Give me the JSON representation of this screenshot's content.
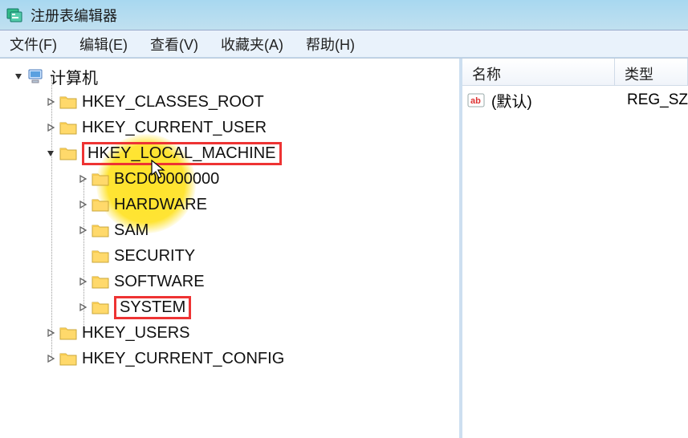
{
  "window": {
    "title": "注册表编辑器"
  },
  "menu": {
    "file": "文件(F)",
    "edit": "编辑(E)",
    "view": "查看(V)",
    "favorites": "收藏夹(A)",
    "help": "帮助(H)"
  },
  "tree": {
    "root": "计算机",
    "hkcr": "HKEY_CLASSES_ROOT",
    "hkcu": "HKEY_CURRENT_USER",
    "hklm": "HKEY_LOCAL_MACHINE",
    "hklm_children": {
      "bcd": "BCD00000000",
      "hardware": "HARDWARE",
      "sam": "SAM",
      "security": "SECURITY",
      "software": "SOFTWARE",
      "system": "SYSTEM"
    },
    "hku": "HKEY_USERS",
    "hkcc": "HKEY_CURRENT_CONFIG"
  },
  "list": {
    "header_name": "名称",
    "header_type": "类型",
    "rows": [
      {
        "name": "(默认)",
        "type": "REG_SZ"
      }
    ]
  }
}
